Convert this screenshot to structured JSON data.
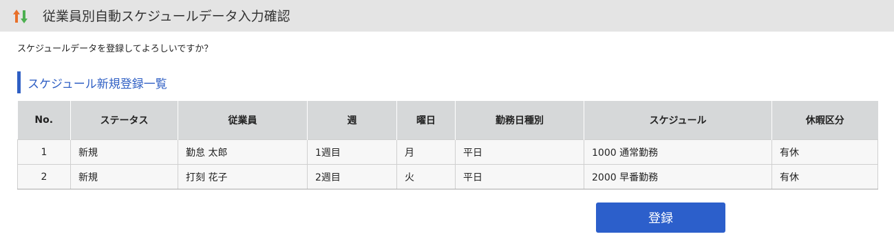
{
  "header": {
    "title": "従業員別自動スケジュールデータ入力確認",
    "icon": "sort-arrows-icon",
    "icon_colors": {
      "up": "#e8702a",
      "down": "#4caf50"
    }
  },
  "confirm_message": "スケジュールデータを登録してよろしいですか？",
  "section": {
    "title": "スケジュール新規登録一覧",
    "accent_color": "#2f5fc4"
  },
  "table": {
    "columns": [
      "No.",
      "ステータス",
      "従業員",
      "週",
      "曜日",
      "勤務日種別",
      "スケジュール",
      "休暇区分"
    ],
    "rows": [
      [
        "1",
        "新規",
        "勤怠 太郎",
        "1週目",
        "月",
        "平日",
        "1000 通常勤務",
        "有休"
      ],
      [
        "2",
        "新規",
        "打刻 花子",
        "2週目",
        "火",
        "平日",
        "2000 早番勤務",
        "有休"
      ]
    ]
  },
  "actions": {
    "register_label": "登録",
    "button_color": "#2c5fcb"
  }
}
